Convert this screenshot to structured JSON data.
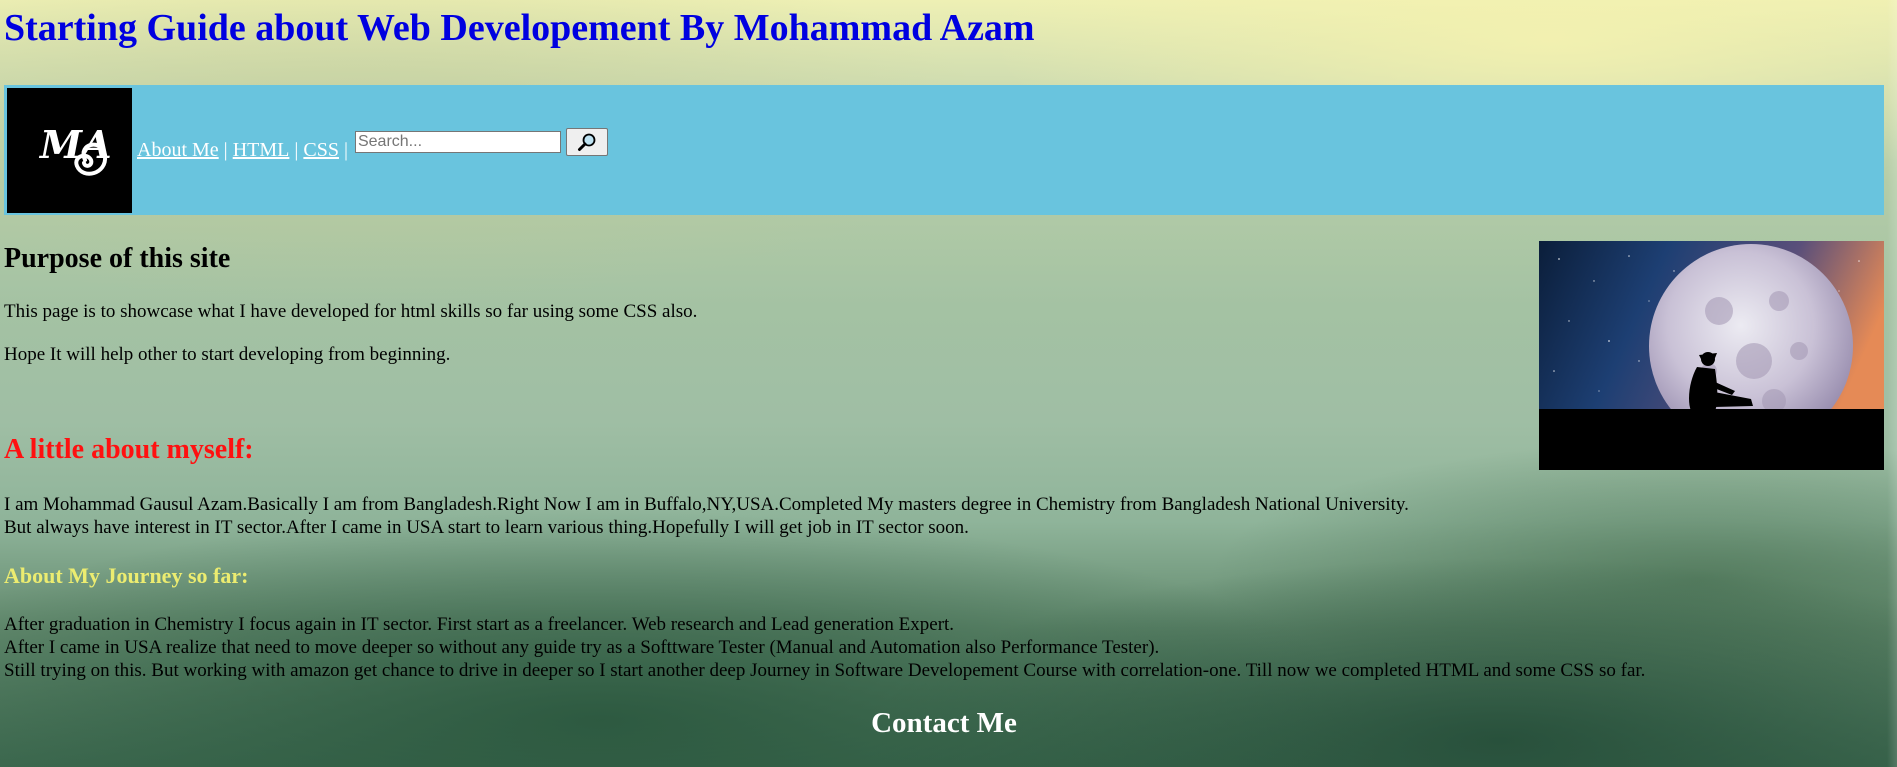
{
  "header": {
    "title": "Starting Guide about Web Developement By Mohammad Azam"
  },
  "nav": {
    "logo_text": "MA",
    "links": [
      {
        "label": "About Me"
      },
      {
        "label": "HTML"
      },
      {
        "label": "CSS"
      }
    ],
    "separator": "|",
    "search_placeholder": "Search...",
    "search_value": "",
    "search_icon": "magnifier-icon"
  },
  "purpose": {
    "heading": "Purpose of this site",
    "paragraphs": [
      "This page is to showcase what I have developed for html skills so far using some CSS also.",
      "Hope It will help other to start developing from beginning."
    ]
  },
  "about": {
    "heading": "A little about myself:",
    "lines": [
      "I am Mohammad Gausul Azam.Basically I am from Bangladesh.Right Now I am in Buffalo,NY,USA.Completed My masters degree in Chemistry from Bangladesh National University.",
      "But always have interest in IT sector.After I came in USA start to learn various thing.Hopefully I will get job in IT sector soon."
    ]
  },
  "journey": {
    "heading": "About My Journey so far:",
    "lines": [
      "After graduation in Chemistry I focus again in IT sector. First start as a freelancer. Web research and Lead generation Expert.",
      "After I came in USA realize that need to move deeper so without any guide try as a Softtware Tester (Manual and Automation also Performance Tester).",
      "Still trying on this. But working with amazon get chance to drive in deeper so I start another deep Journey in Software Developement Course with correlation-one. Till now we completed HTML and some CSS so far."
    ]
  },
  "contact": {
    "heading": "Contact Me"
  },
  "colors": {
    "title": "#0000e0",
    "navbar": "#69c4de",
    "about_heading": "#ff1010",
    "journey_heading": "#ecec70",
    "contact_heading": "#ffffff"
  }
}
